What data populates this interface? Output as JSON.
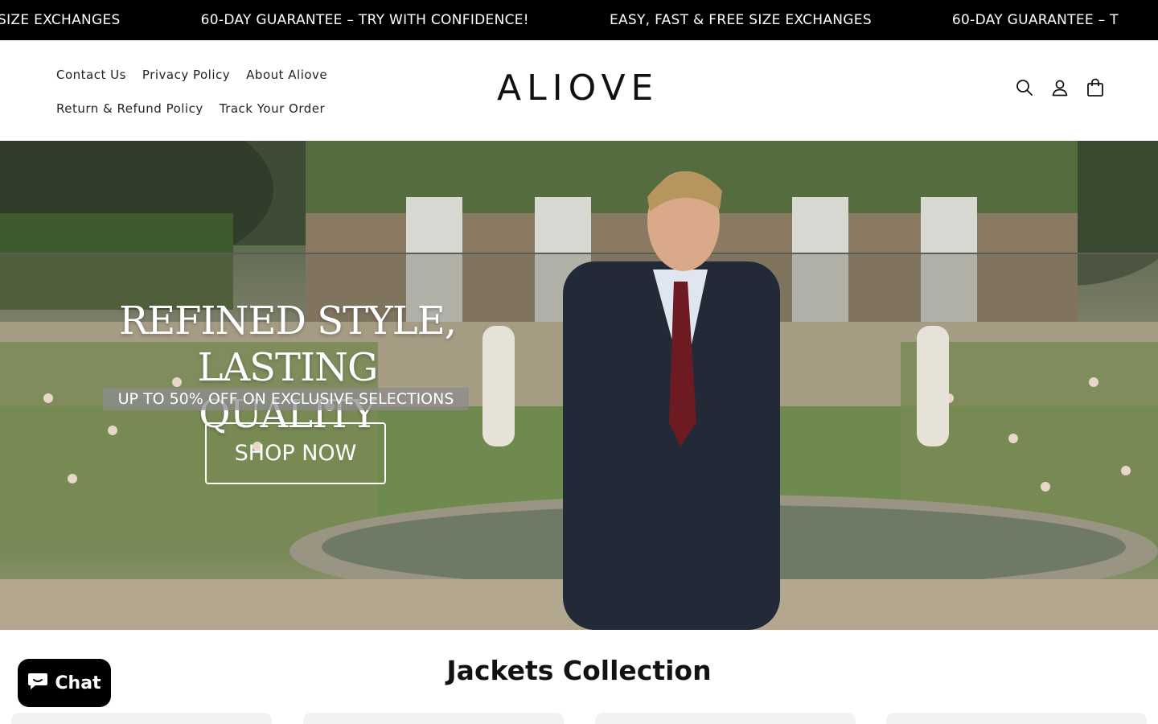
{
  "announcement": {
    "items": [
      "SIZE EXCHANGES",
      "60-DAY GUARANTEE – TRY WITH CONFIDENCE!",
      "EASY, FAST & FREE SIZE EXCHANGES",
      "60-DAY GUARANTEE – T"
    ]
  },
  "header": {
    "nav": [
      {
        "label": "Contact Us"
      },
      {
        "label": "Privacy Policy"
      },
      {
        "label": "About Aliove"
      },
      {
        "label": "Return & Refund Policy"
      },
      {
        "label": "Track Your Order"
      }
    ],
    "logo": "ALIOVE",
    "icons": [
      "search-icon",
      "account-icon",
      "cart-icon"
    ]
  },
  "hero": {
    "headline_line1": "REFINED STYLE,",
    "headline_line2": "LASTING QUALITY",
    "subline": "UP TO 50% OFF ON EXCLUSIVE SELECTIONS",
    "cta": "SHOP NOW"
  },
  "collection": {
    "title": "Jackets Collection"
  },
  "chat": {
    "label": "Chat"
  }
}
